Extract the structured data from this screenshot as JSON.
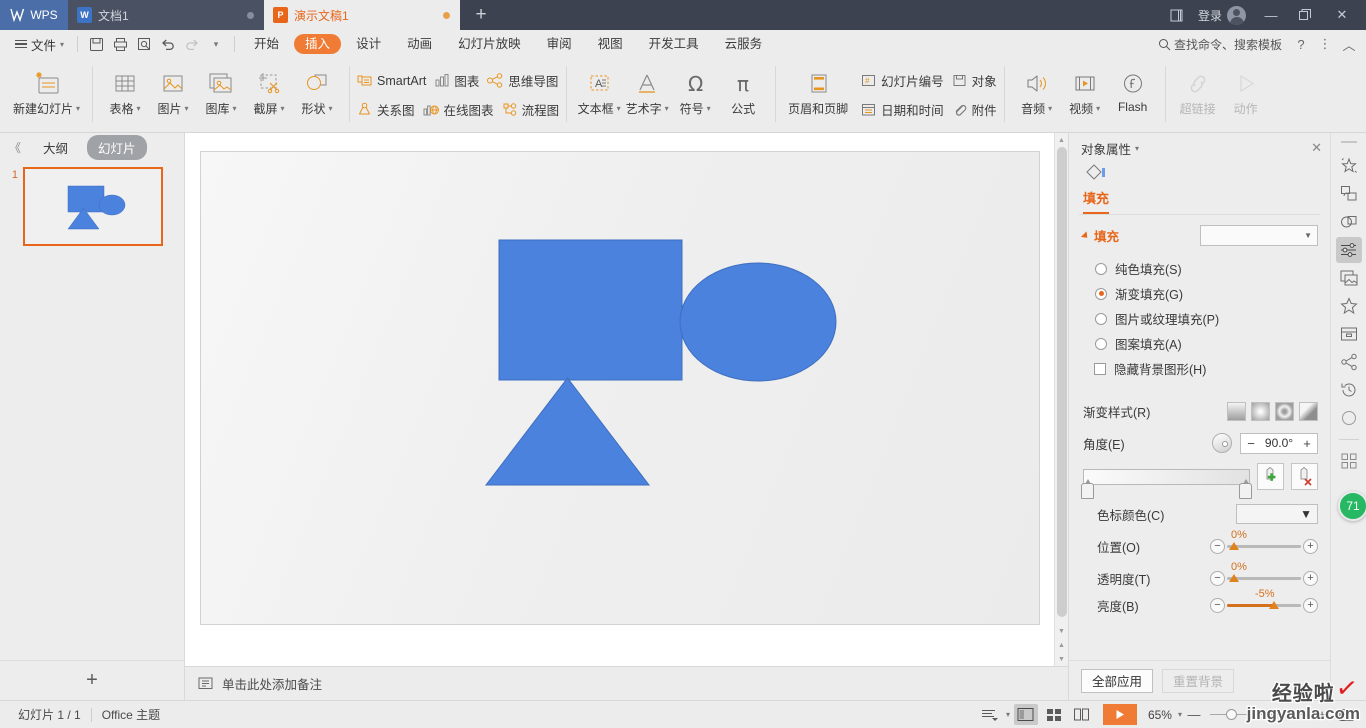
{
  "titlebar": {
    "logo_text": "WPS",
    "tabs": [
      {
        "label": "文档1",
        "icon": "word-doc-icon",
        "type": "w"
      },
      {
        "label": "演示文稿1",
        "icon": "presentation-doc-icon",
        "type": "p"
      }
    ],
    "new_tab_label": "+",
    "login_label": "登录",
    "minimize_label": "—",
    "restore_label": "❐",
    "close_label": "✕"
  },
  "menubar": {
    "file_label": "文件",
    "quick_access": [
      "save-icon",
      "print-icon",
      "print-preview-icon",
      "undo-icon",
      "redo-icon",
      "customize-icon"
    ],
    "tabs": [
      {
        "label": "开始",
        "selected": false
      },
      {
        "label": "插入",
        "selected": true
      },
      {
        "label": "设计",
        "selected": false
      },
      {
        "label": "动画",
        "selected": false
      },
      {
        "label": "幻灯片放映",
        "selected": false
      },
      {
        "label": "审阅",
        "selected": false
      },
      {
        "label": "视图",
        "selected": false
      },
      {
        "label": "开发工具",
        "selected": false
      },
      {
        "label": "云服务",
        "selected": false
      }
    ],
    "search_placeholder": "查找命令、搜索模板",
    "help_label": "?",
    "more_label": "⋮",
    "collapse_label": "︿"
  },
  "ribbon": {
    "new_slide": {
      "label": "新建幻灯片",
      "has_dropdown": true
    },
    "insert_group": [
      {
        "label": "表格",
        "icon": "table-icon",
        "has_dropdown": true
      },
      {
        "label": "图片",
        "icon": "picture-icon",
        "has_dropdown": true
      },
      {
        "label": "图库",
        "icon": "gallery-icon",
        "has_dropdown": true
      },
      {
        "label": "截屏",
        "icon": "screenshot-icon",
        "has_dropdown": true
      },
      {
        "label": "形状",
        "icon": "shapes-icon",
        "has_dropdown": true
      }
    ],
    "diagram_group": [
      {
        "label": "SmartArt",
        "icon": "smartart-icon"
      },
      {
        "label": "图表",
        "icon": "chart-icon"
      },
      {
        "label": "思维导图",
        "icon": "mindmap-icon"
      },
      {
        "label": "关系图",
        "icon": "relation-icon"
      },
      {
        "label": "在线图表",
        "icon": "online-chart-icon"
      },
      {
        "label": "流程图",
        "icon": "flowchart-icon"
      }
    ],
    "text_group": [
      {
        "label": "文本框",
        "icon": "textbox-icon",
        "has_dropdown": true
      },
      {
        "label": "艺术字",
        "icon": "wordart-icon",
        "has_dropdown": true
      },
      {
        "label": "符号",
        "icon": "symbol-icon",
        "has_dropdown": true
      },
      {
        "label": "公式",
        "icon": "formula-icon",
        "has_dropdown": false
      }
    ],
    "header_group": [
      {
        "label": "页眉和页脚",
        "icon": "header-footer-icon"
      },
      {
        "label": "幻灯片编号",
        "icon": "slide-number-icon"
      },
      {
        "label": "日期和时间",
        "icon": "date-time-icon"
      },
      {
        "label": "对象",
        "icon": "object-icon"
      },
      {
        "label": "附件",
        "icon": "attachment-icon"
      }
    ],
    "media_group": [
      {
        "label": "音频",
        "icon": "audio-icon",
        "has_dropdown": true
      },
      {
        "label": "视频",
        "icon": "video-icon",
        "has_dropdown": true
      },
      {
        "label": "Flash",
        "icon": "flash-icon",
        "has_dropdown": false
      }
    ],
    "link_group": [
      {
        "label": "超链接",
        "icon": "hyperlink-icon",
        "disabled": true
      },
      {
        "label": "动作",
        "icon": "action-icon",
        "disabled": true
      }
    ]
  },
  "slidepane": {
    "collapse_label": "《",
    "tab_outline": "大纲",
    "tab_slides": "幻灯片",
    "slides": [
      {
        "number": "1"
      }
    ],
    "add_slide_label": "+"
  },
  "canvas": {
    "shapes": [
      {
        "name": "rectangle-shape",
        "type": "rect",
        "color": "#4a82dd"
      },
      {
        "name": "ellipse-shape",
        "type": "ellipse",
        "color": "#4a82dd"
      },
      {
        "name": "triangle-shape",
        "type": "triangle",
        "color": "#4a82dd"
      }
    ]
  },
  "notes": {
    "placeholder": "单击此处添加备注"
  },
  "rightpanel": {
    "title": "对象属性",
    "close_label": "✕",
    "tab_label": "填充",
    "section_title": "填充",
    "fill_options": [
      {
        "label": "纯色填充(S)",
        "key": "S",
        "selected": false
      },
      {
        "label": "渐变填充(G)",
        "key": "G",
        "selected": true
      },
      {
        "label": "图片或纹理填充(P)",
        "key": "P",
        "selected": false
      },
      {
        "label": "图案填充(A)",
        "key": "A",
        "selected": false
      }
    ],
    "hide_bg_label": "隐藏背景图形(H)",
    "gradient_style_label": "渐变样式(R)",
    "angle_label": "角度(E)",
    "angle_value": "90.0°",
    "minus_label": "−",
    "plus_label": "+",
    "stop_color_label": "色标颜色(C)",
    "position_label": "位置(O)",
    "position_value": "0%",
    "transparency_label": "透明度(T)",
    "transparency_value": "0%",
    "brightness_label": "亮度(B)",
    "brightness_value": "-5%",
    "apply_all_label": "全部应用",
    "reset_bg_label": "重置背景"
  },
  "rail": {
    "items": [
      {
        "name": "effects-icon",
        "selected": false
      },
      {
        "name": "swap-shape-icon",
        "selected": false
      },
      {
        "name": "combine-shapes-icon",
        "selected": false
      },
      {
        "name": "properties-sliders-icon",
        "selected": true
      },
      {
        "name": "picture-frame-icon",
        "selected": false
      },
      {
        "name": "favorites-star-icon",
        "selected": false
      },
      {
        "name": "archive-box-icon",
        "selected": false
      },
      {
        "name": "share-icon",
        "selected": false
      },
      {
        "name": "history-icon",
        "selected": false
      },
      {
        "name": "apps-grid-icon",
        "selected": false
      }
    ],
    "badge_value": "71"
  },
  "statusbar": {
    "slide_count": "幻灯片 1 / 1",
    "theme": "Office 主题",
    "views": [
      {
        "name": "outline-view-icon",
        "selected": false
      },
      {
        "name": "normal-view-icon",
        "selected": true
      },
      {
        "name": "slide-sorter-icon",
        "selected": false
      },
      {
        "name": "reading-view-icon",
        "selected": false
      }
    ],
    "play_label": "▶",
    "zoom_value": "65%",
    "zoom_minus": "—",
    "zoom_plus": "+"
  },
  "watermark": {
    "line1": "经验啦",
    "line2": "jingyanla.com",
    "check": "✓"
  },
  "colors": {
    "accent": "#e8661a",
    "shape_blue": "#4a82dd",
    "titlebar": "#3c4250",
    "play_green": "#26b862"
  }
}
